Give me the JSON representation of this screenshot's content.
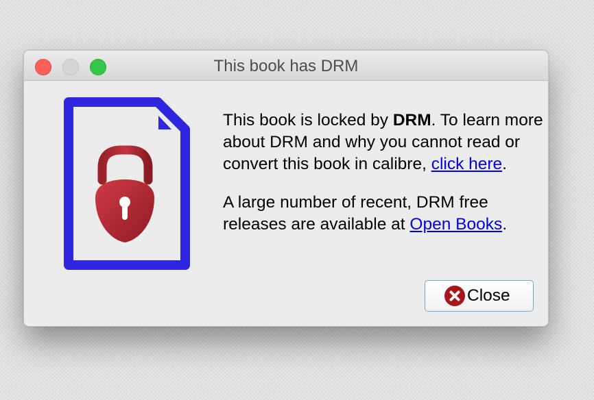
{
  "window": {
    "title": "This book has DRM"
  },
  "message": {
    "para1_before": "This book is locked by ",
    "para1_bold": "DRM",
    "para1_after": ". To learn more about DRM and why you cannot read or convert this book in calibre, ",
    "para1_link": "click here",
    "para1_end": ".",
    "para2_before": "A large number of recent, DRM free releases are available at ",
    "para2_link": "Open Books",
    "para2_end": "."
  },
  "buttons": {
    "close_label": "Close"
  },
  "icons": {
    "document": "locked-document-icon",
    "close": "close-circle-icon"
  },
  "colors": {
    "document_outline": "#2f27e0",
    "lock": "#b02a33",
    "link": "#0000ee",
    "close_icon": "#a8151b"
  }
}
